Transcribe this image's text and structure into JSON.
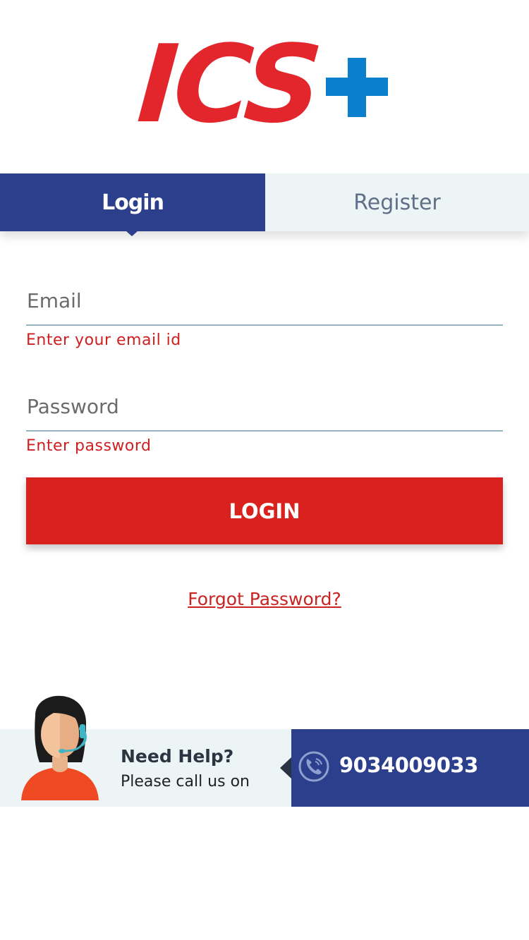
{
  "brand": {
    "logo_text": "ICS",
    "logo_plus": "+",
    "colors": {
      "logo_red": "#e3262c",
      "logo_blue": "#0a7fcc",
      "primary_navy": "#2c3f8c",
      "button_red": "#d9221d",
      "error_red": "#cf1f1f"
    }
  },
  "tabs": [
    {
      "label": "Login",
      "active": true
    },
    {
      "label": "Register",
      "active": false
    }
  ],
  "form": {
    "email": {
      "placeholder": "Email",
      "value": "",
      "error": "Enter your email id"
    },
    "password": {
      "placeholder": "Password",
      "value": "",
      "error": "Enter password"
    },
    "submit_label": "LOGIN",
    "forgot_label": "Forgot Password?"
  },
  "help": {
    "title": "Need Help?",
    "subtitle": "Please call us on",
    "phone": "9034009033",
    "icons": {
      "avatar": "support-agent-icon",
      "phone": "phone-icon"
    }
  }
}
